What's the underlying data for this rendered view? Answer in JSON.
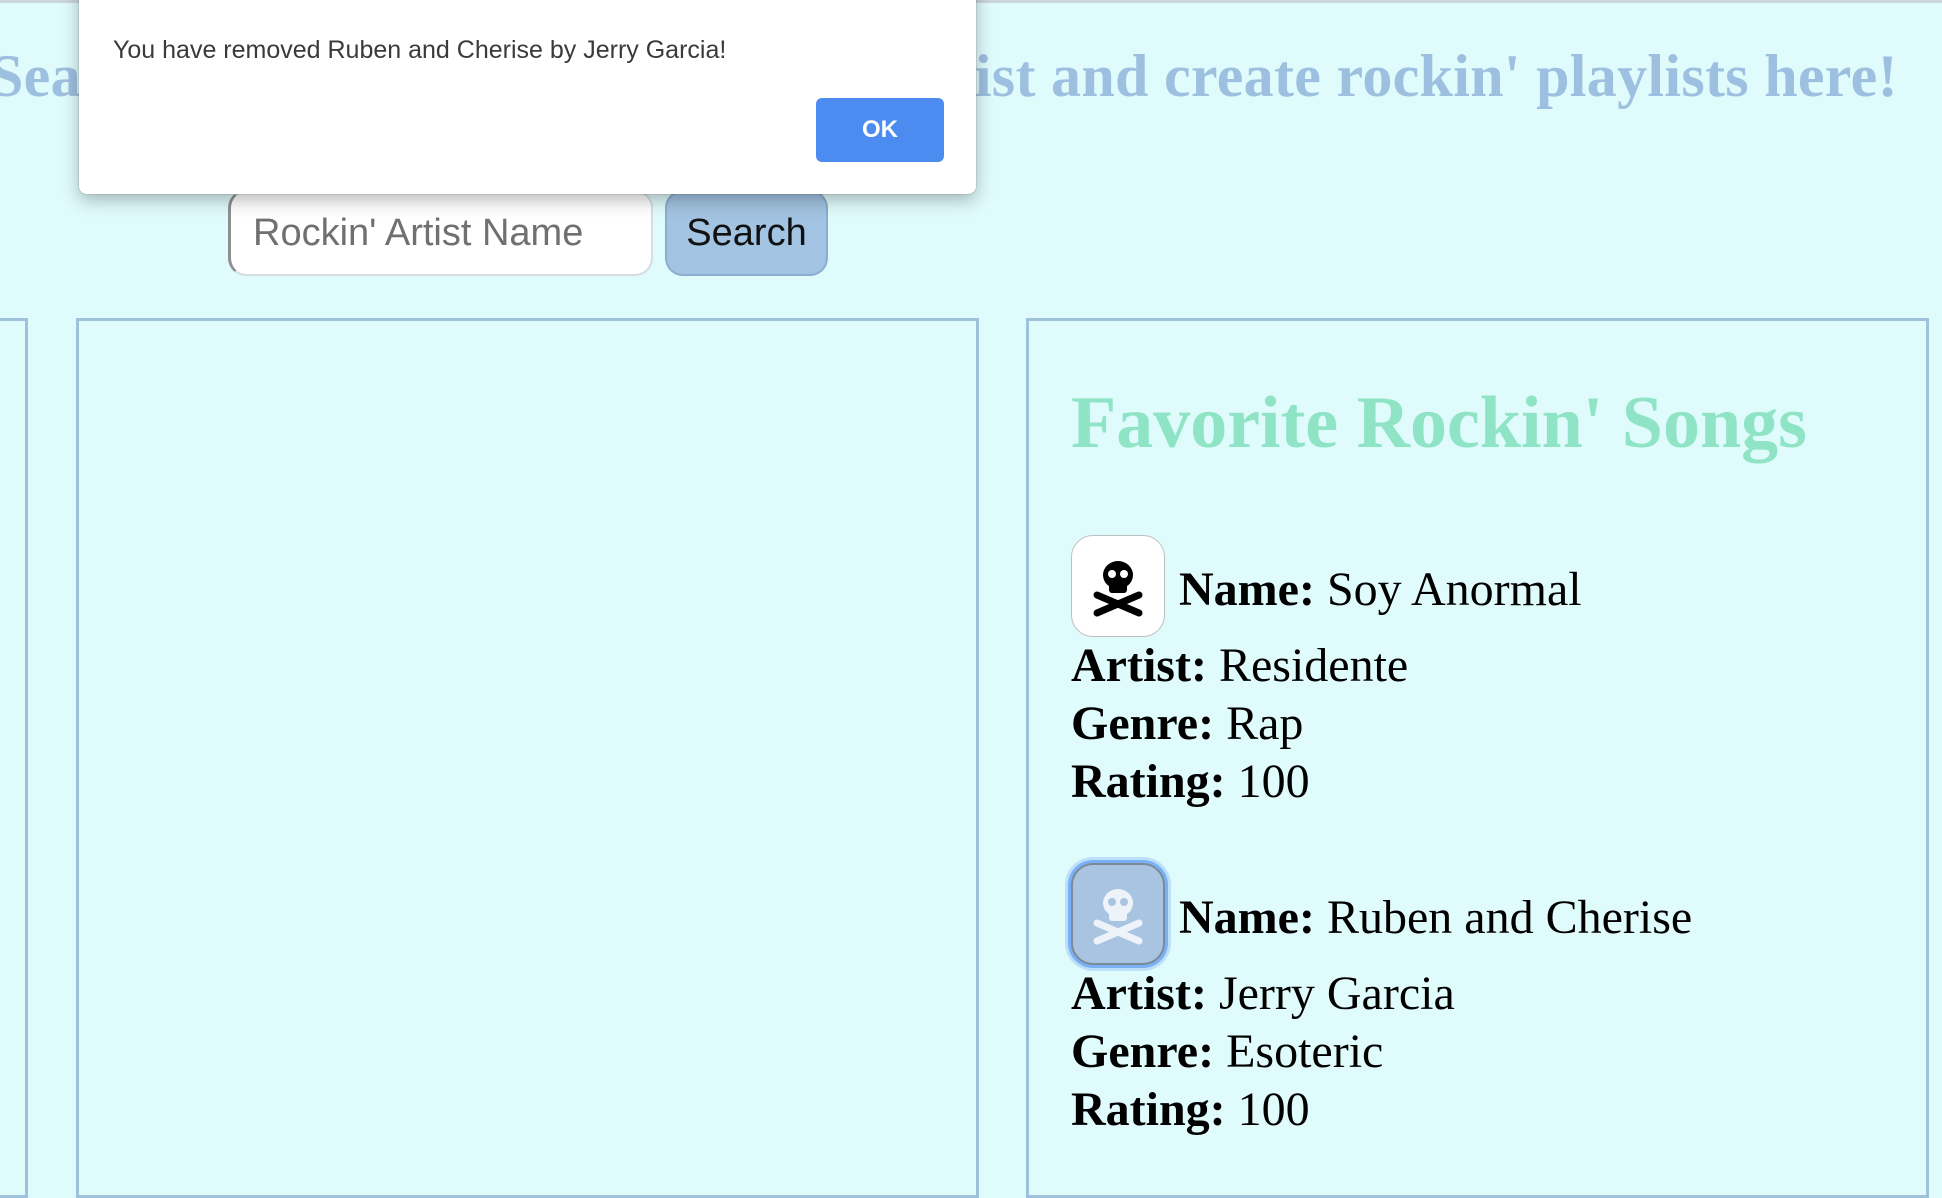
{
  "header": {
    "headline": "Search for and select your favorite artist and create rockin' playlists here!"
  },
  "search": {
    "placeholder": "Rockin' Artist Name",
    "button_label": "Search"
  },
  "favorites": {
    "title": "Favorite Rockin' Songs",
    "labels": {
      "name": "Name:",
      "artist": "Artist:",
      "genre": "Genre:",
      "rating": "Rating:"
    },
    "songs": [
      {
        "name": "Soy Anormal",
        "artist": "Residente",
        "genre": "Rap",
        "rating": "100",
        "remove_icon": "skull-crossbones-icon"
      },
      {
        "name": "Ruben and Cherise",
        "artist": "Jerry Garcia",
        "genre": "Esoteric",
        "rating": "100",
        "remove_icon": "skull-crossbones-icon"
      }
    ]
  },
  "alert": {
    "message": "You have removed Ruben and Cherise by Jerry Garcia!",
    "ok_label": "OK"
  },
  "colors": {
    "background": "#e0fbfc",
    "headline": "#9dc0e0",
    "favorites_title": "#8ee4c4",
    "panel_border": "#9ec2dc",
    "alert_button": "#4c8bef"
  }
}
